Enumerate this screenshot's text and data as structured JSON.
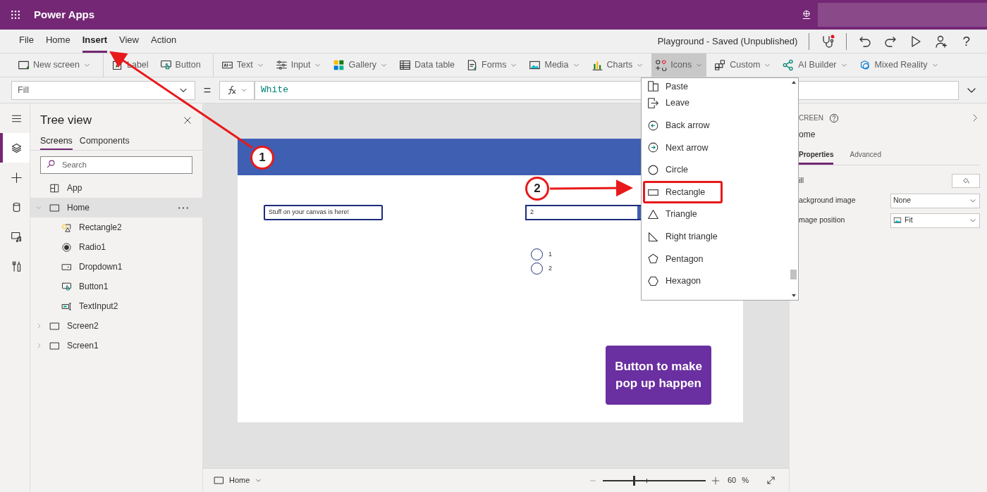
{
  "app_bar": {
    "title": "Power Apps"
  },
  "menu_tabs": [
    {
      "label": "File",
      "selected": false
    },
    {
      "label": "Home",
      "selected": false
    },
    {
      "label": "Insert",
      "selected": true
    },
    {
      "label": "View",
      "selected": false
    },
    {
      "label": "Action",
      "selected": false
    }
  ],
  "save_status": "Playground - Saved (Unpublished)",
  "help_label": "?",
  "ribbon": [
    {
      "items": [
        {
          "label": "New screen",
          "kind": "new_screen",
          "has_menu": true,
          "selected": false
        }
      ]
    },
    {
      "items": [
        {
          "label": "Label",
          "kind": "label",
          "has_menu": false,
          "selected": false
        },
        {
          "label": "Button",
          "kind": "button",
          "has_menu": false,
          "selected": false
        }
      ]
    },
    {
      "items": [
        {
          "label": "Text",
          "kind": "text",
          "has_menu": true,
          "selected": false
        },
        {
          "label": "Input",
          "kind": "input",
          "has_menu": true,
          "selected": false
        },
        {
          "label": "Gallery",
          "kind": "gallery",
          "has_menu": true,
          "selected": false
        },
        {
          "label": "Data table",
          "kind": "data_table",
          "has_menu": false,
          "selected": false
        },
        {
          "label": "Forms",
          "kind": "forms",
          "has_menu": true,
          "selected": false
        },
        {
          "label": "Media",
          "kind": "media",
          "has_menu": true,
          "selected": false
        },
        {
          "label": "Charts",
          "kind": "charts",
          "has_menu": true,
          "selected": false
        },
        {
          "label": "Icons",
          "kind": "icons",
          "has_menu": true,
          "selected": true
        },
        {
          "label": "Custom",
          "kind": "custom",
          "has_menu": true,
          "selected": false
        },
        {
          "label": "AI Builder",
          "kind": "ai_builder",
          "has_menu": true,
          "selected": false
        },
        {
          "label": "Mixed Reality",
          "kind": "mixed_reality",
          "has_menu": true,
          "selected": false
        }
      ]
    }
  ],
  "formula_bar": {
    "property": "Fill",
    "operator": "=",
    "formula": "White"
  },
  "rail": [
    {
      "kind": "menu",
      "selected": false
    },
    {
      "kind": "layers",
      "selected": true
    },
    {
      "kind": "plus",
      "selected": false
    },
    {
      "kind": "data",
      "selected": false
    },
    {
      "kind": "media",
      "selected": false
    },
    {
      "kind": "tools",
      "selected": false
    }
  ],
  "tree_view": {
    "title": "Tree view",
    "tabs": [
      {
        "label": "Screens",
        "selected": true
      },
      {
        "label": "Components",
        "selected": false
      }
    ],
    "search": {
      "placeholder": "Search"
    },
    "items": [
      {
        "label": "App",
        "kind": "app",
        "selected": false
      },
      {
        "label": "Home",
        "kind": "screen",
        "selected": true,
        "expanded": true,
        "children": [
          {
            "label": "Rectangle2",
            "kind": "rectangle",
            "selected": false
          },
          {
            "label": "Radio1",
            "kind": "radio",
            "selected": false
          },
          {
            "label": "Dropdown1",
            "kind": "dropdown",
            "selected": false
          },
          {
            "label": "Button1",
            "kind": "button",
            "selected": false
          },
          {
            "label": "TextInput2",
            "kind": "text_input",
            "selected": false
          }
        ]
      },
      {
        "label": "Screen2",
        "kind": "screen",
        "selected": false,
        "expanded": false
      },
      {
        "label": "Screen1",
        "kind": "screen",
        "selected": false,
        "expanded": false
      }
    ]
  },
  "canvas": {
    "text_input": {
      "value": "Stuff on your canvas is here!"
    },
    "dropdown": {
      "value": "2"
    },
    "radio_options": [
      {
        "label": "1",
        "selected": false
      },
      {
        "label": "2",
        "selected": false
      }
    ],
    "button": {
      "label": "Button to make pop up happen"
    }
  },
  "icons_menu": {
    "items": [
      {
        "label": "Paste",
        "kind": "paste",
        "highlighted": false
      },
      {
        "label": "Leave",
        "kind": "leave",
        "highlighted": false
      },
      {
        "label": "Back arrow",
        "kind": "back_arrow",
        "highlighted": false
      },
      {
        "label": "Next arrow",
        "kind": "next_arrow",
        "highlighted": false
      },
      {
        "label": "Circle",
        "kind": "circle",
        "highlighted": false
      },
      {
        "label": "Rectangle",
        "kind": "rectangle",
        "highlighted": true
      },
      {
        "label": "Triangle",
        "kind": "triangle",
        "highlighted": false
      },
      {
        "label": "Right triangle",
        "kind": "right_triangle",
        "highlighted": false
      },
      {
        "label": "Pentagon",
        "kind": "pentagon",
        "highlighted": false
      },
      {
        "label": "Hexagon",
        "kind": "hexagon",
        "highlighted": false
      }
    ]
  },
  "properties_panel": {
    "type_label": "CREEN",
    "name": "ome",
    "tabs": [
      {
        "label": "Properties",
        "selected": true
      },
      {
        "label": "Advanced",
        "selected": false
      }
    ],
    "rows": [
      {
        "label": "ill",
        "kind": "color"
      },
      {
        "label": "ackground image",
        "kind": "select",
        "value": "None"
      },
      {
        "label": "mage position",
        "kind": "image_select",
        "value": "Fit"
      }
    ]
  },
  "status_bar": {
    "screen": "Home",
    "zoom_slider": {
      "level": 0.3
    },
    "zoom_value": "60",
    "zoom_unit": "%"
  },
  "annotations": [
    {
      "number": "1"
    },
    {
      "number": "2"
    }
  ]
}
